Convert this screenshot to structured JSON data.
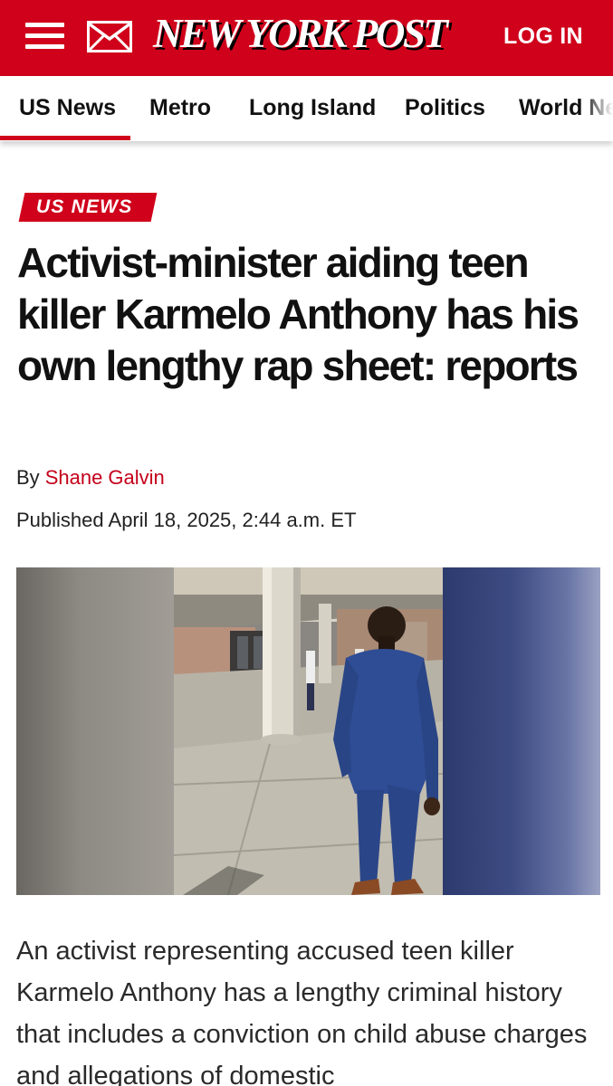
{
  "header": {
    "logo_text": "NEW YORK POST",
    "login_label": "LOG IN",
    "menu_icon": "hamburger-menu-icon",
    "mail_icon": "envelope-icon",
    "brand_color": "#d0021b"
  },
  "nav": {
    "items": [
      {
        "label": "US News",
        "active": true
      },
      {
        "label": "Metro",
        "active": false
      },
      {
        "label": "Long Island",
        "active": false
      },
      {
        "label": "Politics",
        "active": false
      },
      {
        "label": "World News",
        "active": false
      }
    ]
  },
  "article": {
    "category": "US NEWS",
    "headline": "Activist-minister aiding teen killer Karmelo Anthony has his own lengthy rap sheet: reports",
    "byline_prefix": "By",
    "author": "Shane Galvin",
    "published": "Published April 18, 2025, 2:44 a.m. ET",
    "body": "An activist representing accused teen killer Karmelo Anthony has a lengthy criminal history that includes a conviction on child abuse charges and allegations of domestic"
  }
}
